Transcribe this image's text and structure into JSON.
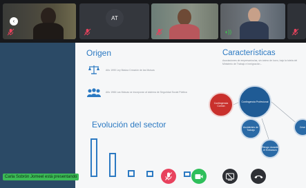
{
  "participants": [
    {
      "id": "p1",
      "mic": "muted"
    },
    {
      "id": "p2",
      "initials": "AT",
      "mic": "muted"
    },
    {
      "id": "p3",
      "mic": "muted"
    },
    {
      "id": "p4",
      "mic": "active"
    },
    {
      "id": "p5"
    }
  ],
  "slide": {
    "origen_title": "Origen",
    "caracteristicas_title": "Características",
    "evolucion_title": "Evolución del sector",
    "origen_line1": "Año 1990 Ley Básica Creación de las Mutuas",
    "origen_line2": "Año 1966 Las Mutuas se incorporan al sistema de Seguridad Social Pública",
    "caract_text": "Asociaciones de empresarios/as, sin ánimo de lucro, bajo la tutela del Ministerio de Trabajo e Inmigración...",
    "bubbles": {
      "red": "Contingencia Común",
      "big": "Contingencia Profesional",
      "b1": "Accidentes de Trabajo",
      "b2": "Riesgo durante el Embarazo",
      "b3": "Cese"
    }
  },
  "chart_data": {
    "type": "bar",
    "title": "Evolución del sector",
    "values": [
      100,
      63,
      18,
      16,
      14,
      14
    ]
  },
  "presenting_banner": "Carla Sobrón Jomeel está presentando",
  "colors": {
    "accent": "#2b79c2",
    "mic_muted": "#e8425d",
    "camera_on": "#2fbf5b",
    "banner": "#3cba56"
  }
}
